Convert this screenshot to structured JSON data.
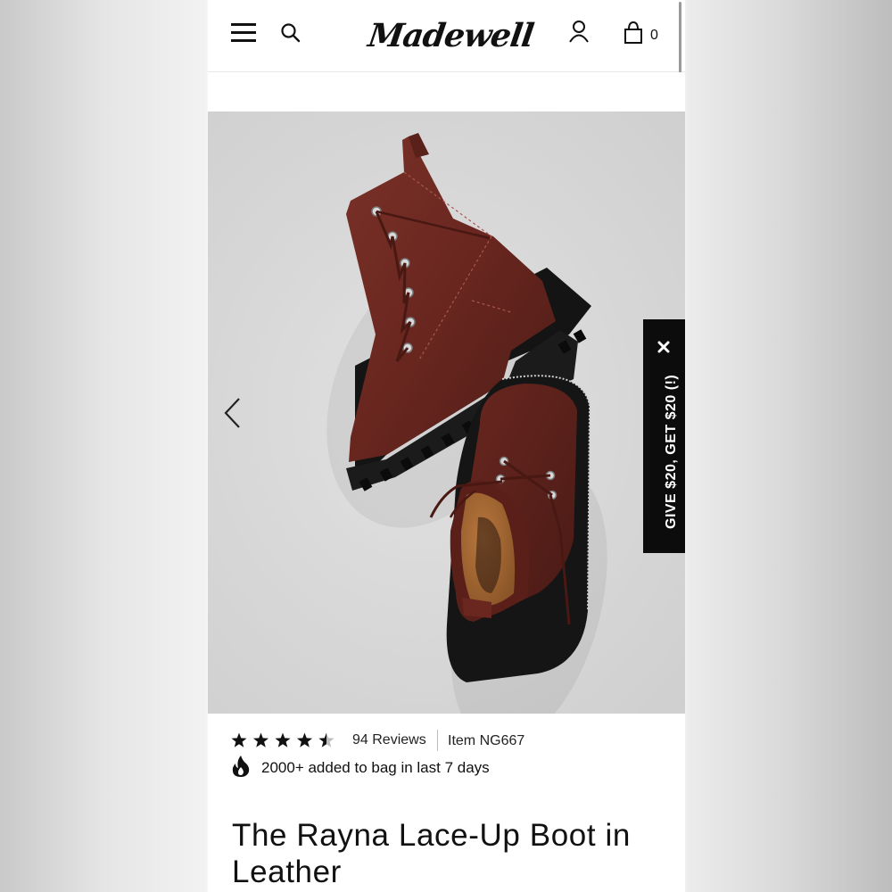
{
  "header": {
    "brand": "Madewell",
    "cart_count": "0",
    "menu_icon": "hamburger-menu-icon",
    "search_icon": "search-icon",
    "account_icon": "user-icon",
    "cart_icon": "shopping-bag-icon"
  },
  "hero": {
    "prev_icon": "chevron-left-icon",
    "promo_label": "GIVE $20, GET $20 (!)",
    "promo_close": "✕"
  },
  "product": {
    "rating": 4.5,
    "rating_max": 5,
    "reviews": "94 Reviews",
    "item": "Item NG667",
    "bag_activity": "2000+ added to bag in last 7 days",
    "activity_icon": "flame-icon",
    "title": "The Rayna Lace-Up Boot in Leather"
  },
  "colors": {
    "boot": "#6e2a22",
    "sole": "#161616",
    "hero_bg": "#d8d8d8",
    "promo_bg": "#0c0c0c"
  }
}
